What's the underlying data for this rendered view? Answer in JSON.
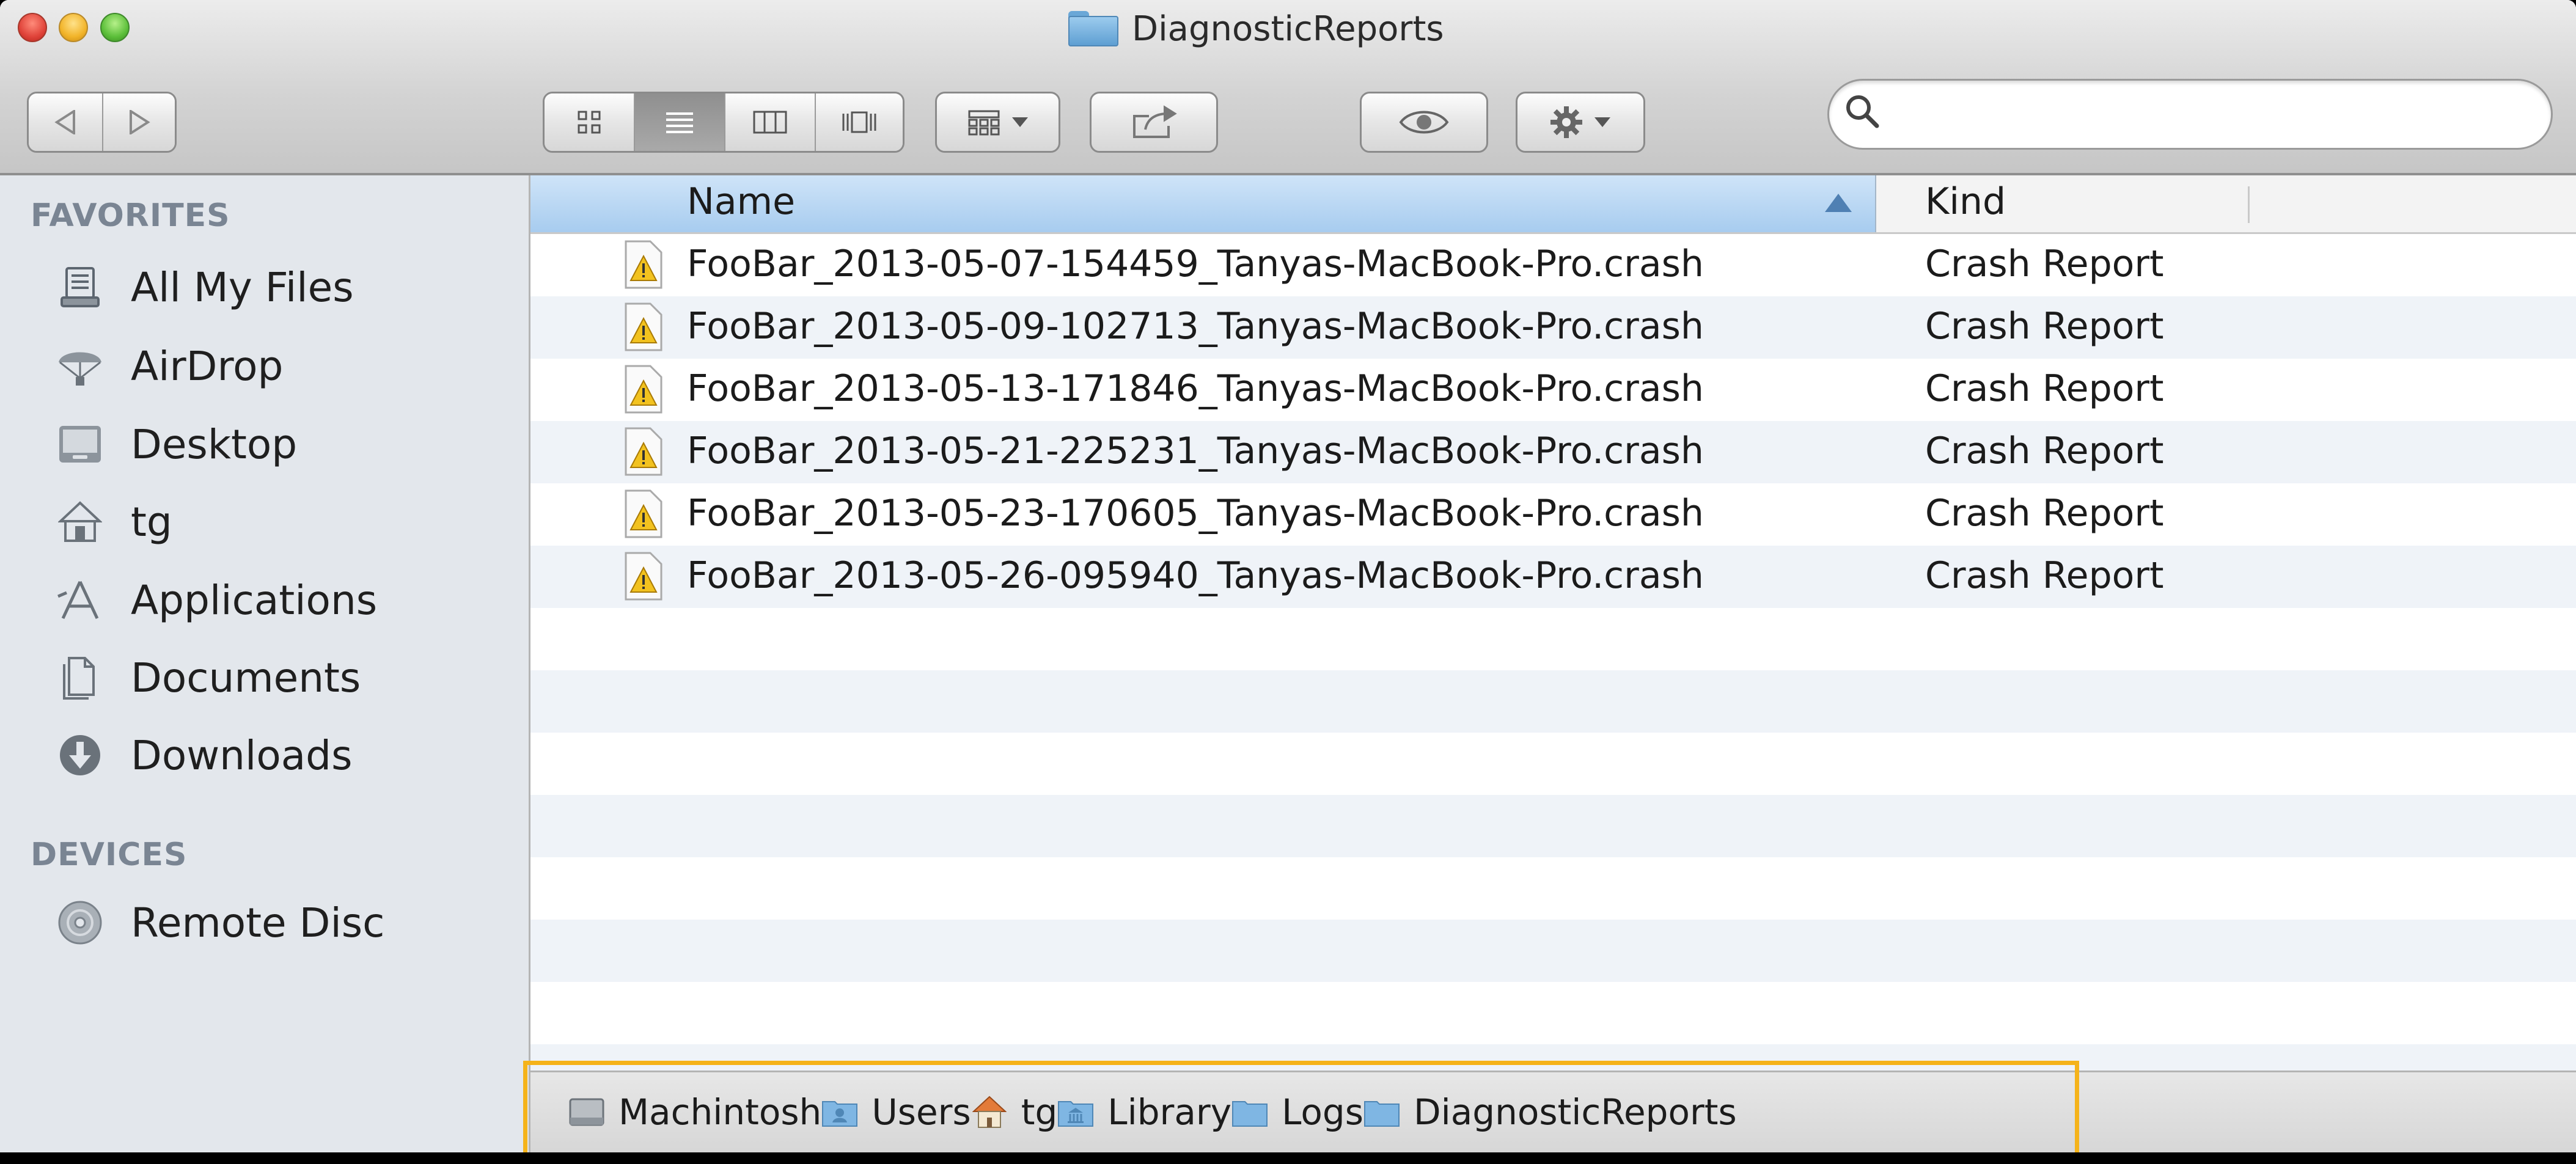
{
  "window": {
    "title": "DiagnosticReports"
  },
  "toolbar": {
    "view_modes": [
      "icon",
      "list",
      "column",
      "cover-flow"
    ],
    "active_view": "list",
    "search": {
      "placeholder": "",
      "value": ""
    }
  },
  "sidebar": {
    "favorites_heading": "FAVORITES",
    "favorites": [
      {
        "label": "All My Files",
        "icon": "all-my-files-icon"
      },
      {
        "label": "AirDrop",
        "icon": "airdrop-icon"
      },
      {
        "label": "Desktop",
        "icon": "desktop-icon"
      },
      {
        "label": "tg",
        "icon": "home-icon"
      },
      {
        "label": "Applications",
        "icon": "applications-icon"
      },
      {
        "label": "Documents",
        "icon": "documents-icon"
      },
      {
        "label": "Downloads",
        "icon": "downloads-icon"
      }
    ],
    "devices_heading": "DEVICES",
    "devices": [
      {
        "label": "Remote Disc",
        "icon": "remote-disc-icon"
      }
    ]
  },
  "list": {
    "columns": {
      "name": "Name",
      "kind": "Kind"
    },
    "sorted_by": "Name",
    "rows": [
      {
        "name": "FooBar_2013-05-07-154459_Tanyas-MacBook-Pro.crash",
        "kind": "Crash Report"
      },
      {
        "name": "FooBar_2013-05-09-102713_Tanyas-MacBook-Pro.crash",
        "kind": "Crash Report"
      },
      {
        "name": "FooBar_2013-05-13-171846_Tanyas-MacBook-Pro.crash",
        "kind": "Crash Report"
      },
      {
        "name": "FooBar_2013-05-21-225231_Tanyas-MacBook-Pro.crash",
        "kind": "Crash Report"
      },
      {
        "name": "FooBar_2013-05-23-170605_Tanyas-MacBook-Pro.crash",
        "kind": "Crash Report"
      },
      {
        "name": "FooBar_2013-05-26-095940_Tanyas-MacBook-Pro.crash",
        "kind": "Crash Report"
      }
    ]
  },
  "pathbar": {
    "crumbs": [
      {
        "label": "Machintosh",
        "icon": "hard-drive-icon"
      },
      {
        "label": "Users",
        "icon": "users-folder-icon"
      },
      {
        "label": "tg",
        "icon": "home-icon"
      },
      {
        "label": "Library",
        "icon": "library-folder-icon"
      },
      {
        "label": "Logs",
        "icon": "folder-icon"
      },
      {
        "label": "DiagnosticReports",
        "icon": "folder-icon"
      }
    ]
  },
  "colors": {
    "highlight": "#f5b31a",
    "header_selected": "#a7ccef",
    "row_alt": "#eff3f8",
    "sidebar_bg": "#e3e7ec"
  }
}
